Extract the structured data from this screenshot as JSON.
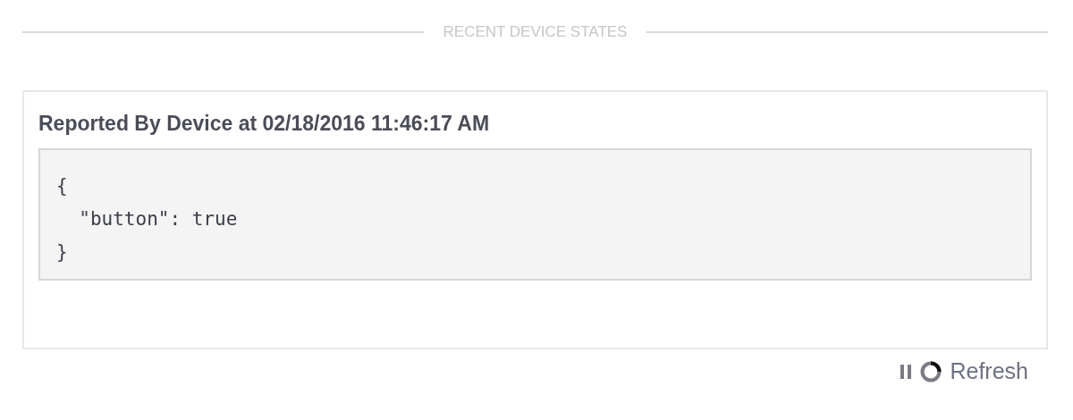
{
  "section_title": "RECENT DEVICE STATES",
  "card": {
    "title": "Reported By Device at 02/18/2016 11:46:17 AM",
    "code_lines": [
      "{",
      "  \"button\": true",
      "}"
    ]
  },
  "footer": {
    "refresh_label": "Refresh"
  }
}
